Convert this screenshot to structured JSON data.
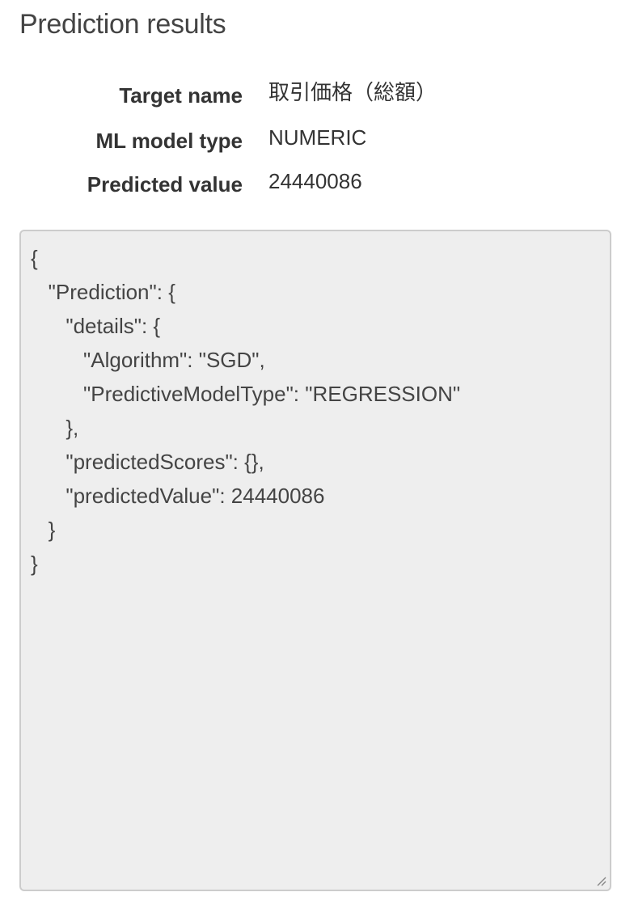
{
  "page": {
    "title": "Prediction results"
  },
  "summary": {
    "rows": [
      {
        "label": "Target name",
        "value": "取引価格（総額）"
      },
      {
        "label": "ML model type",
        "value": "NUMERIC"
      },
      {
        "label": "Predicted value",
        "value": "24440086"
      }
    ]
  },
  "json_output": {
    "text": "{\n   \"Prediction\": {\n      \"details\": {\n         \"Algorithm\": \"SGD\",\n         \"PredictiveModelType\": \"REGRESSION\"\n      },\n      \"predictedScores\": {},\n      \"predictedValue\": 24440086\n   }\n}"
  },
  "icons": {
    "resize": "resize-handle-icon"
  },
  "colors": {
    "box_background": "#eeeeee",
    "box_border": "#cccccc",
    "text": "#333333"
  }
}
